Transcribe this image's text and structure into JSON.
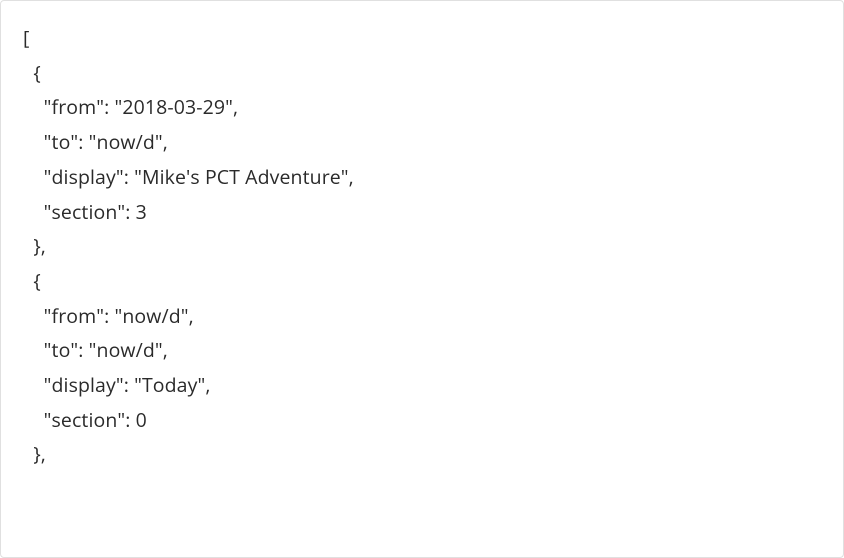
{
  "code": {
    "lines": [
      "[",
      "  {",
      "    \"from\": \"2018-03-29\",",
      "    \"to\": \"now/d\",",
      "    \"display\": \"Mike's PCT Adventure\",",
      "    \"section\": 3",
      "  },",
      "  {",
      "    \"from\": \"now/d\",",
      "    \"to\": \"now/d\",",
      "    \"display\": \"Today\",",
      "    \"section\": 0",
      "  },"
    ]
  }
}
